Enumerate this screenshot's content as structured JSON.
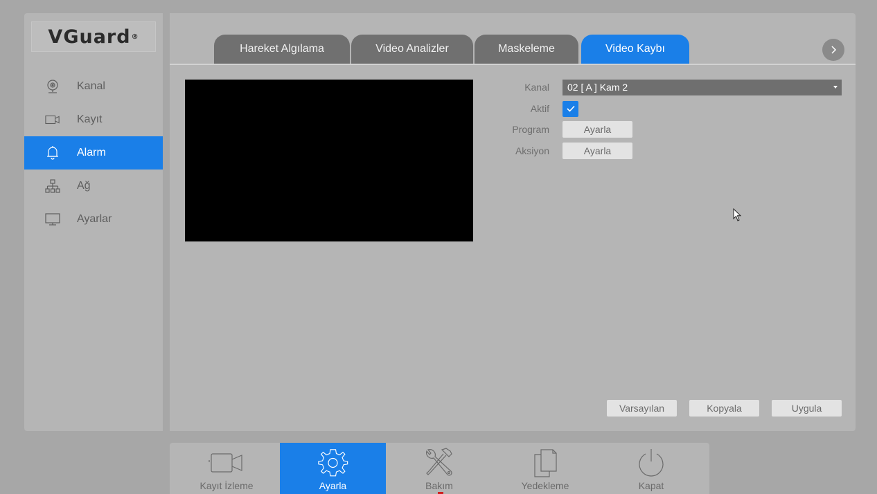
{
  "brand": {
    "logo_text": "VGuard",
    "logo_mark": "®"
  },
  "sidebar": {
    "items": [
      {
        "label": "Kanal",
        "icon": "webcam-icon",
        "active": false
      },
      {
        "label": "Kayıt",
        "icon": "video-camera-icon",
        "active": false
      },
      {
        "label": "Alarm",
        "icon": "bell-icon",
        "active": true
      },
      {
        "label": "Ağ",
        "icon": "network-icon",
        "active": false
      },
      {
        "label": "Ayarlar",
        "icon": "monitor-icon",
        "active": false
      }
    ]
  },
  "tabs": [
    {
      "label": "Hareket Algılama",
      "active": false
    },
    {
      "label": "Video Analizler",
      "active": false
    },
    {
      "label": "Maskeleme",
      "active": false
    },
    {
      "label": "Video Kaybı",
      "active": true
    }
  ],
  "form": {
    "kanal_label": "Kanal",
    "kanal_value": "02 [ A ] Kam 2",
    "aktif_label": "Aktif",
    "aktif_checked": true,
    "program_label": "Program",
    "program_button": "Ayarla",
    "aksiyon_label": "Aksiyon",
    "aksiyon_button": "Ayarla"
  },
  "actions": {
    "default_label": "Varsayılan",
    "copy_label": "Kopyala",
    "apply_label": "Uygula"
  },
  "bottombar": {
    "items": [
      {
        "label": "Kayıt İzleme",
        "icon": "video-camera-icon",
        "active": false
      },
      {
        "label": "Ayarla",
        "icon": "gear-icon",
        "active": true
      },
      {
        "label": "Bakım",
        "icon": "tools-icon",
        "active": false
      },
      {
        "label": "Yedekleme",
        "icon": "copy-files-icon",
        "active": false
      },
      {
        "label": "Kapat",
        "icon": "power-icon",
        "active": false
      }
    ]
  },
  "colors": {
    "accent": "#1a7fe8",
    "panel": "#b5b5b5",
    "background": "#a7a7a7",
    "tab_inactive": "#707070"
  }
}
